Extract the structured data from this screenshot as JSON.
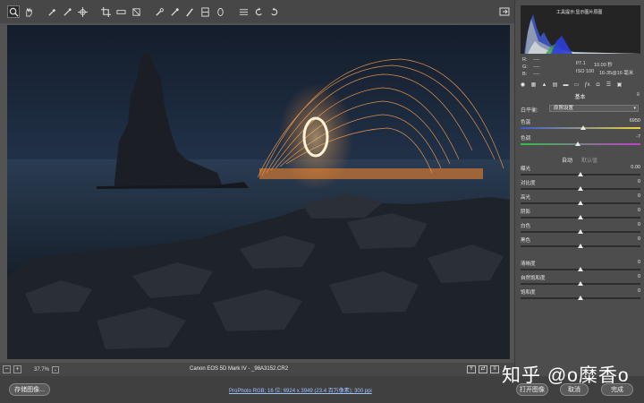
{
  "toolbar": {
    "tools": [
      "zoom-icon",
      "hand-icon",
      "white-balance-icon",
      "color-sampler-icon",
      "target-adjust-icon",
      "crop-icon",
      "straighten-icon",
      "spot-removal-icon",
      "red-eye-icon",
      "adjustment-brush-icon",
      "graduated-filter-icon",
      "radial-filter-icon",
      "preferences-icon",
      "rotate-left-icon",
      "rotate-right-icon"
    ]
  },
  "histogram": {
    "label": "工具提示:显示图片原图"
  },
  "info": {
    "r_label": "R:",
    "g_label": "G:",
    "b_label": "B:",
    "r_val": "----",
    "g_val": "----",
    "b_val": "----",
    "aperture": "f/7.1",
    "shutter": "10.00 秒",
    "iso": "ISO 100",
    "lens": "16-35@16 毫米"
  },
  "panel": {
    "section_title": "基本",
    "wb_label": "白平衡:",
    "wb_value": "原照设置",
    "temp_label": "色温",
    "temp_value": "6950",
    "tint_label": "色调",
    "tint_value": "-7",
    "auto_label": "自动",
    "default_label": "默认值",
    "sliders": [
      {
        "label": "曝光",
        "value": "0.00",
        "pos": 0.5
      },
      {
        "label": "对比度",
        "value": "0",
        "pos": 0.5
      },
      {
        "label": "高光",
        "value": "0",
        "pos": 0.5
      },
      {
        "label": "阴影",
        "value": "0",
        "pos": 0.5
      },
      {
        "label": "白色",
        "value": "0",
        "pos": 0.5
      },
      {
        "label": "黑色",
        "value": "0",
        "pos": 0.5
      },
      {
        "label": "清晰度",
        "value": "0",
        "pos": 0.5
      },
      {
        "label": "自然饱和度",
        "value": "0",
        "pos": 0.5
      },
      {
        "label": "饱和度",
        "value": "0",
        "pos": 0.5
      }
    ],
    "temp_pos": 0.52,
    "tint_pos": 0.48
  },
  "status": {
    "zoom_level": "37.7%",
    "camera": "Canon EOS 5D Mark IV - _98A3152.CR2"
  },
  "bottom": {
    "save_label": "存储图像...",
    "workflow": "ProPhoto RGB; 16 位; 6924 x 3949 (23.4 百万像素); 300 ppi",
    "open_label": "打开图像",
    "cancel_label": "取消",
    "done_label": "完成",
    "watermark": "知乎 @o糜香o"
  },
  "colors": {
    "accent": "#9cc1ff",
    "panel_bg": "#4d4d4d",
    "toolbar_bg": "#474747"
  }
}
